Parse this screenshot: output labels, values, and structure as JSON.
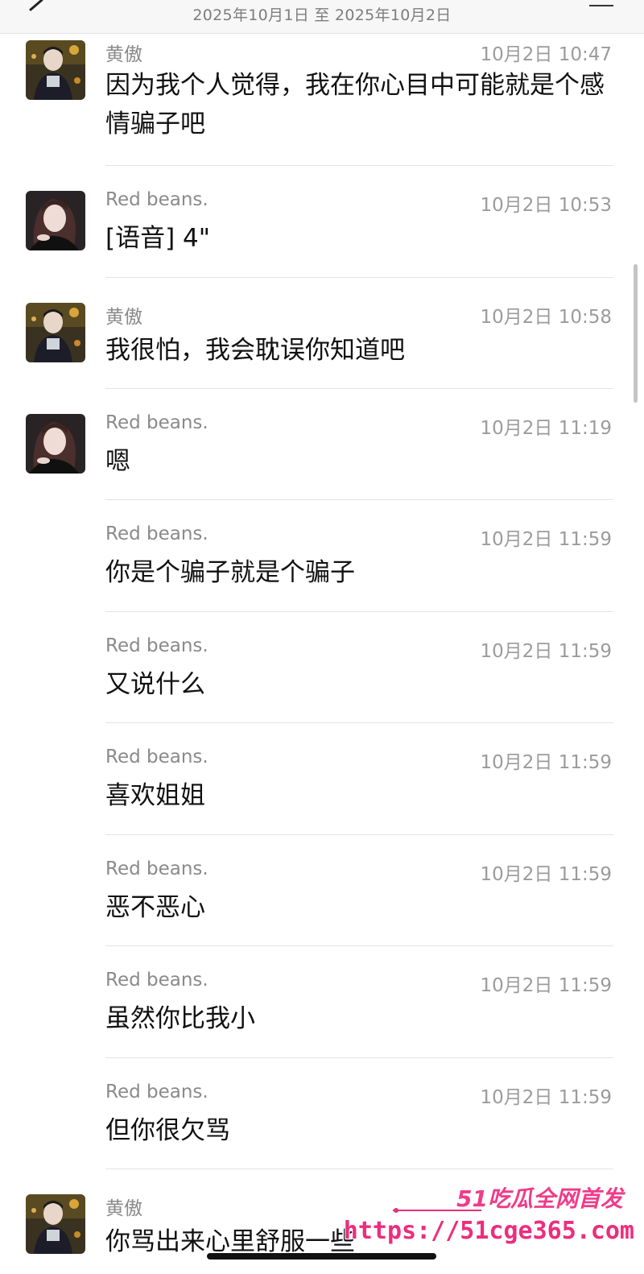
{
  "header": {
    "date_range": "2025年10月1日 至 2025年10月2日"
  },
  "messages": [
    {
      "sender": "黄傲",
      "time": "10月2日 10:47",
      "text": "因为我个人觉得，我在你心目中可能就是个感情骗子吧",
      "avatar": "male-avatar"
    },
    {
      "sender": "Red  beans.",
      "time": "10月2日 10:53",
      "text": "[语音] 4\"",
      "avatar": "female-avatar"
    },
    {
      "sender": "黄傲",
      "time": "10月2日 10:58",
      "text": "我很怕，我会耽误你知道吧",
      "avatar": "male-avatar"
    },
    {
      "sender": "Red  beans.",
      "time": "10月2日 11:19",
      "text": "嗯",
      "avatar": "female-avatar"
    },
    {
      "sender": "Red  beans.",
      "time": "10月2日 11:59",
      "text": "你是个骗子就是个骗子",
      "avatar": ""
    },
    {
      "sender": "Red  beans.",
      "time": "10月2日 11:59",
      "text": "又说什么",
      "avatar": ""
    },
    {
      "sender": "Red  beans.",
      "time": "10月2日 11:59",
      "text": "喜欢姐姐",
      "avatar": ""
    },
    {
      "sender": "Red  beans.",
      "time": "10月2日 11:59",
      "text": "恶不恶心",
      "avatar": ""
    },
    {
      "sender": "Red  beans.",
      "time": "10月2日 11:59",
      "text": "虽然你比我小",
      "avatar": ""
    },
    {
      "sender": "Red  beans.",
      "time": "10月2日 11:59",
      "text": "但你很欠骂",
      "avatar": ""
    },
    {
      "sender": "黄傲",
      "time": "",
      "text": "你骂出来心里舒服一些",
      "avatar": "male-avatar"
    }
  ],
  "watermark": {
    "logo": "51吃瓜全网首发",
    "url": "https://51cge365.com"
  },
  "colors": {
    "watermark": "#ec2d7d",
    "meta_text": "#8a8a8a"
  }
}
